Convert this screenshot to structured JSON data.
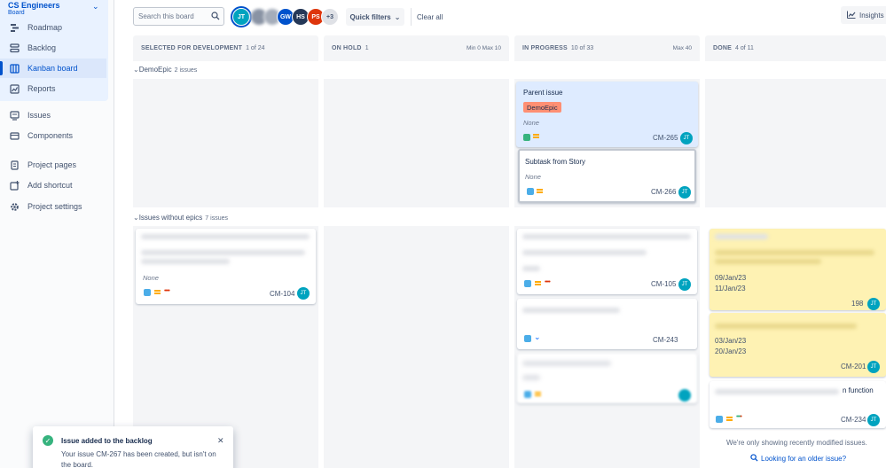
{
  "sidebar": {
    "project_name": "CS Engineers",
    "project_type": "Board",
    "items": [
      {
        "label": "Roadmap",
        "icon": "roadmap-icon"
      },
      {
        "label": "Backlog",
        "icon": "backlog-icon"
      },
      {
        "label": "Kanban board",
        "icon": "board-icon",
        "active": true
      },
      {
        "label": "Reports",
        "icon": "reports-icon"
      },
      {
        "label": "Issues",
        "icon": "issues-icon"
      },
      {
        "label": "Components",
        "icon": "components-icon"
      },
      {
        "label": "Project pages",
        "icon": "pages-icon"
      },
      {
        "label": "Add shortcut",
        "icon": "add-shortcut-icon"
      },
      {
        "label": "Project settings",
        "icon": "gear-icon"
      }
    ]
  },
  "toolbar": {
    "search_placeholder": "Search this board",
    "avatars": [
      {
        "initials": "JT",
        "color": "#00a3bf"
      },
      {
        "initials": "",
        "color": "#8993a4"
      },
      {
        "initials": "",
        "color": "#a5adba"
      },
      {
        "initials": "GW",
        "color": "#0052cc"
      },
      {
        "initials": "HS",
        "color": "#253858"
      },
      {
        "initials": "PS",
        "color": "#de350b"
      },
      {
        "initials": "+3",
        "color": "#dfe1e6"
      }
    ],
    "quick_filters": "Quick filters",
    "clear_all": "Clear all",
    "insights": "Insights"
  },
  "columns": [
    {
      "title": "SELECTED FOR DEVELOPMENT",
      "count": "1 of 24",
      "limits": ""
    },
    {
      "title": "ON HOLD",
      "count": "1",
      "limits": "Min 0  Max 10"
    },
    {
      "title": "IN PROGRESS",
      "count": "10 of 33",
      "limits": "Max 40"
    },
    {
      "title": "DONE",
      "count": "4 of 11",
      "limits": ""
    }
  ],
  "swimlanes": {
    "epic": {
      "name": "DemoEpic",
      "count": "2 issues"
    },
    "noepic": {
      "name": "Issues without epics",
      "count": "7 issues"
    }
  },
  "cards": {
    "parent": {
      "title": "Parent issue",
      "epic": "DemoEpic",
      "none": "None",
      "key": "CM-265",
      "assignee": "JT"
    },
    "subtask": {
      "title": "Subtask from Story",
      "none": "None",
      "key": "CM-266",
      "assignee": "JT"
    },
    "cm104": {
      "none": "None",
      "key": "CM-104",
      "assignee": "JT"
    },
    "cm105": {
      "key": "CM-105",
      "assignee": "JT"
    },
    "cm243": {
      "key": "CM-243"
    },
    "cm198": {
      "date1": "09/Jan/23",
      "date2": "11/Jan/23",
      "key": "198",
      "assignee": "JT"
    },
    "cm201": {
      "date1": "03/Jan/23",
      "date2": "20/Jan/23",
      "key": "CM-201",
      "assignee": "JT"
    },
    "cm234": {
      "title_tail": "n function",
      "key": "CM-234",
      "assignee": "JT"
    }
  },
  "done_note": "We're only showing recently modified issues.",
  "older_link": "Looking for an older issue?",
  "toast": {
    "title": "Issue added to the backlog",
    "body": "Your issue CM-267 has been created, but isn't on the board."
  }
}
